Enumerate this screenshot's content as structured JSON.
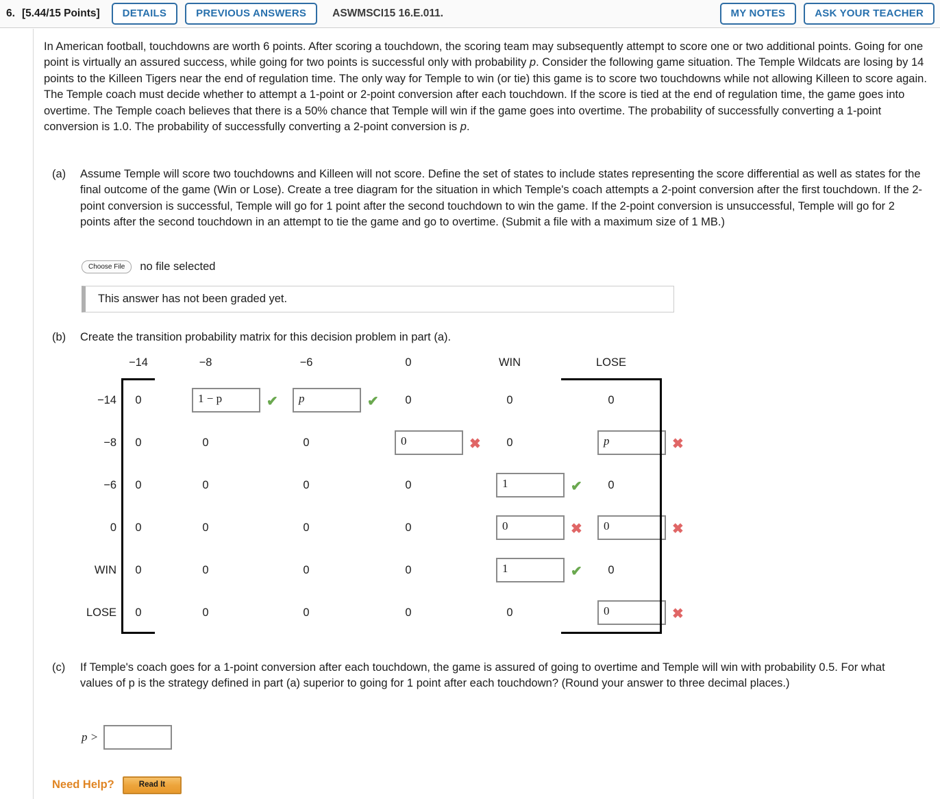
{
  "header": {
    "question_number": "6.",
    "points": "[5.44/15 Points]",
    "details_label": "DETAILS",
    "previous_answers_label": "PREVIOUS ANSWERS",
    "question_code": "ASWMSCI15 16.E.011.",
    "my_notes_label": "MY NOTES",
    "ask_teacher_label": "ASK YOUR TEACHER",
    "accent_color": "#2770ad"
  },
  "intro": {
    "p1_a": "In American football, touchdowns are worth 6 points. After scoring a touchdown, the scoring team may subsequently attempt to score one or two additional points. Going for one point is virtually an assured success, while going for two points is successful only with probability ",
    "p1_var1": "p",
    "p1_b": ". Consider the following game situation. The Temple Wildcats are losing by 14 points to the Killeen Tigers near the end of regulation time. The only way for Temple to win (or tie) this game is to score two touchdowns while not allowing Killeen to score again. The Temple coach must decide whether to attempt a 1-point or 2-point conversion after each touchdown. If the score is tied at the end of regulation time, the game goes into overtime. The Temple coach believes that there is a 50% chance that Temple will win if the game goes into overtime. The probability of successfully converting a 1-point conversion is 1.0. The probability of successfully converting a 2-point conversion is ",
    "p1_var2": "p",
    "p1_c": "."
  },
  "part_a": {
    "label": "(a)",
    "text": "Assume Temple will score two touchdowns and Killeen will not score. Define the set of states to include states representing the score differential as well as states for the final outcome of the game (Win or Lose). Create a tree diagram for the situation in which Temple's coach attempts a 2-point conversion after the first touchdown. If the 2-point conversion is successful, Temple will go for 1 point after the second touchdown to win the game. If the 2-point conversion is unsuccessful, Temple will go for 2 points after the second touchdown in an attempt to tie the game and go to overtime. (Submit a file with a maximum size of 1 MB.)",
    "choose_file_label": "Choose File",
    "file_status": "no file selected",
    "grading_status": "This answer has not been graded yet."
  },
  "part_b": {
    "label": "(b)",
    "text": "Create the transition probability matrix for this decision problem in part (a)."
  },
  "matrix": {
    "col_headers": [
      "−14",
      "−8",
      "−6",
      "0",
      "WIN",
      "LOSE"
    ],
    "row_headers": [
      "−14",
      "−8",
      "−6",
      "0",
      "WIN",
      "LOSE"
    ],
    "rows": [
      [
        {
          "kind": "static",
          "value": "0"
        },
        {
          "kind": "input",
          "value": "1 − p",
          "mark": "check"
        },
        {
          "kind": "input",
          "value": "p",
          "mark": "check"
        },
        {
          "kind": "static",
          "value": "0"
        },
        {
          "kind": "static",
          "value": "0"
        },
        {
          "kind": "static",
          "value": "0"
        }
      ],
      [
        {
          "kind": "static",
          "value": "0"
        },
        {
          "kind": "static",
          "value": "0"
        },
        {
          "kind": "static",
          "value": "0"
        },
        {
          "kind": "input",
          "value": "0",
          "mark": "cross"
        },
        {
          "kind": "static",
          "value": "0"
        },
        {
          "kind": "input",
          "value": "p",
          "mark": "cross"
        }
      ],
      [
        {
          "kind": "static",
          "value": "0"
        },
        {
          "kind": "static",
          "value": "0"
        },
        {
          "kind": "static",
          "value": "0"
        },
        {
          "kind": "static",
          "value": "0"
        },
        {
          "kind": "input",
          "value": "1",
          "mark": "check"
        },
        {
          "kind": "static",
          "value": "0"
        }
      ],
      [
        {
          "kind": "static",
          "value": "0"
        },
        {
          "kind": "static",
          "value": "0"
        },
        {
          "kind": "static",
          "value": "0"
        },
        {
          "kind": "static",
          "value": "0"
        },
        {
          "kind": "input",
          "value": "0",
          "mark": "cross"
        },
        {
          "kind": "input",
          "value": "0",
          "mark": "cross"
        }
      ],
      [
        {
          "kind": "static",
          "value": "0"
        },
        {
          "kind": "static",
          "value": "0"
        },
        {
          "kind": "static",
          "value": "0"
        },
        {
          "kind": "static",
          "value": "0"
        },
        {
          "kind": "input",
          "value": "1",
          "mark": "check"
        },
        {
          "kind": "static",
          "value": "0"
        }
      ],
      [
        {
          "kind": "static",
          "value": "0"
        },
        {
          "kind": "static",
          "value": "0"
        },
        {
          "kind": "static",
          "value": "0"
        },
        {
          "kind": "static",
          "value": "0"
        },
        {
          "kind": "static",
          "value": "0"
        },
        {
          "kind": "input",
          "value": "0",
          "mark": "cross"
        }
      ]
    ],
    "check_glyph": "✔",
    "cross_glyph": "✖",
    "check_color": "#6aa84f",
    "cross_color": "#e06666"
  },
  "part_c": {
    "label": "(c)",
    "text": "If Temple's coach goes for a 1-point conversion after each touchdown, the game is assured of going to overtime and Temple will win with probability 0.5. For what values of p is the strategy defined in part (a) superior to going for 1 point after each touchdown? (Round your answer to three decimal places.)",
    "answer_prefix": "p >",
    "answer_value": "",
    "answer_placeholder": ""
  },
  "footer": {
    "need_help_label": "Need Help?",
    "read_it_label": "Read It",
    "need_help_color": "#e08523"
  }
}
